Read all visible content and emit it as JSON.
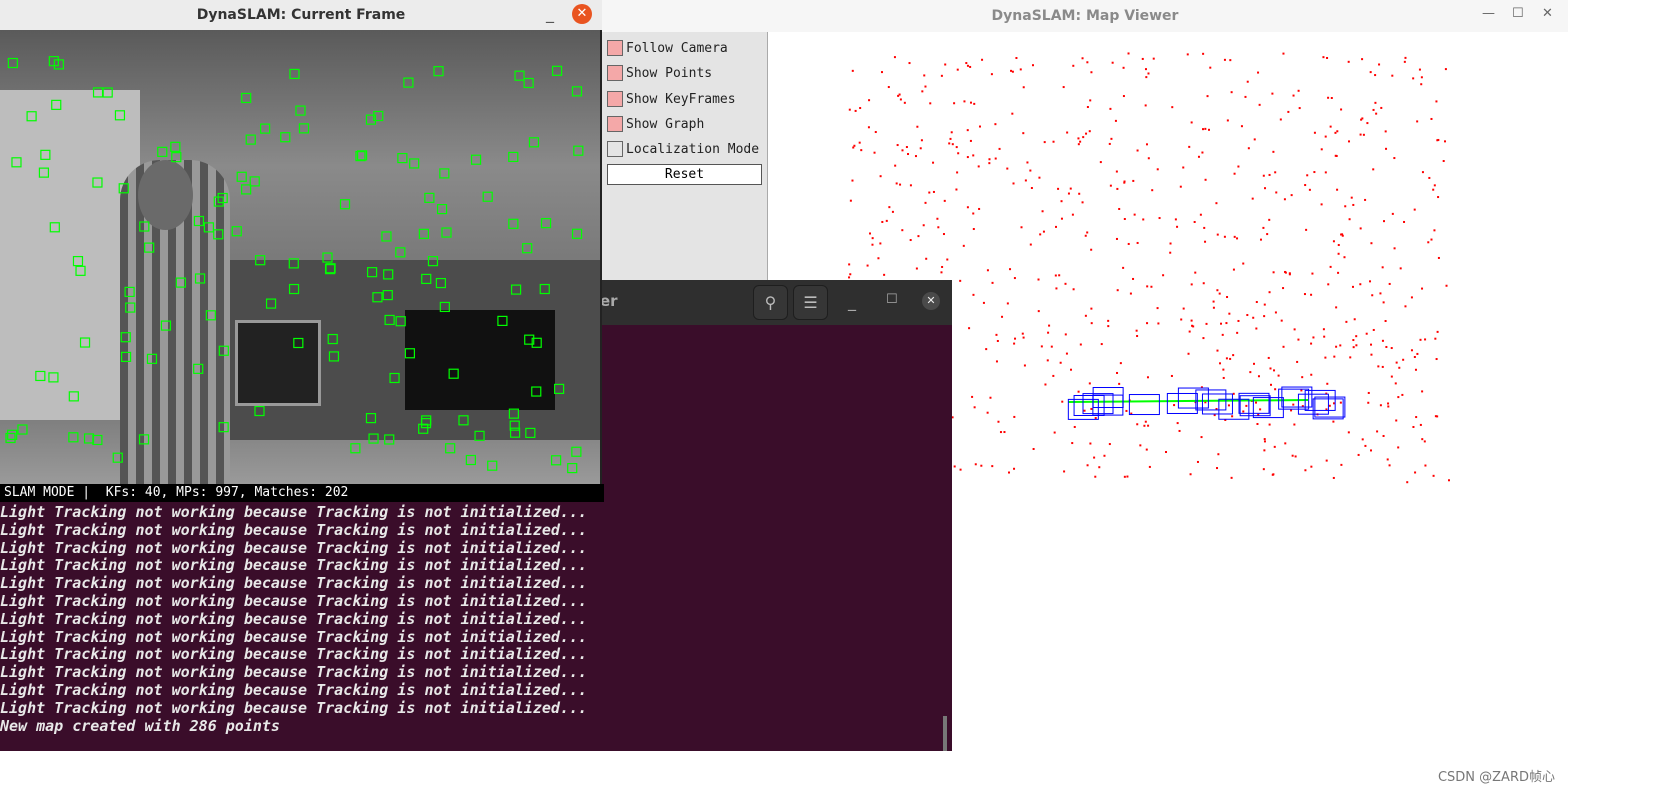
{
  "map_viewer": {
    "title": "DynaSLAM: Map Viewer",
    "options": [
      {
        "label": "Follow Camera",
        "checked": true
      },
      {
        "label": "Show Points",
        "checked": true
      },
      {
        "label": "Show KeyFrames",
        "checked": true
      },
      {
        "label": "Show Graph",
        "checked": true
      },
      {
        "label": "Localization Mode",
        "checked": false
      }
    ],
    "reset_label": "Reset",
    "colors": {
      "map_points": "#ff0000",
      "keyframes": "#0000ff",
      "graph": "#00ff00"
    }
  },
  "current_frame": {
    "title": "DynaSLAM: Current Frame",
    "status": "SLAM MODE |  KFs: 40, MPs: 997, Matches: 202",
    "feature_color": "#00ff00"
  },
  "terminal": {
    "title_fragment": "er",
    "lines": [
      "Light Tracking not working because Tracking is not initialized...",
      "Light Tracking not working because Tracking is not initialized...",
      "Light Tracking not working because Tracking is not initialized...",
      "Light Tracking not working because Tracking is not initialized...",
      "Light Tracking not working because Tracking is not initialized...",
      "Light Tracking not working because Tracking is not initialized...",
      "Light Tracking not working because Tracking is not initialized...",
      "Light Tracking not working because Tracking is not initialized...",
      "Light Tracking not working because Tracking is not initialized...",
      "Light Tracking not working because Tracking is not initialized...",
      "Light Tracking not working because Tracking is not initialized...",
      "Light Tracking not working because Tracking is not initialized...",
      "New map created with 286 points"
    ]
  },
  "watermark": "CSDN @ZARD帧心"
}
